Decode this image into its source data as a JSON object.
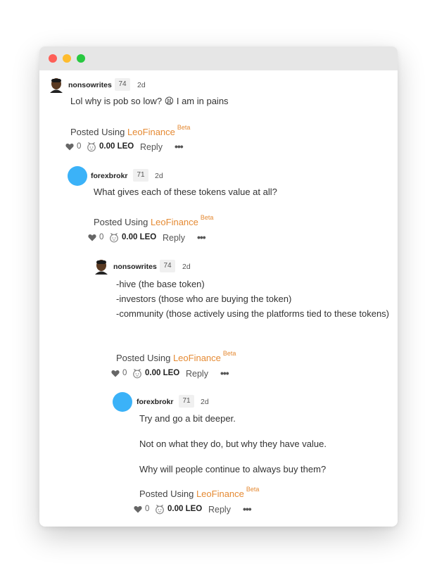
{
  "comments": [
    {
      "username": "nonsowrites",
      "reputation": "74",
      "time": "2d",
      "avatar": "avatar-person-icon",
      "body": [
        "Lol why is pob so low? 😫 I am in pains"
      ],
      "posted_prefix": "Posted Using",
      "posted_link": "LeoFinance",
      "posted_badge": "Beta",
      "votes": "0",
      "payout": "0.00 LEO",
      "reply_label": "Reply",
      "more_label": "•••"
    },
    {
      "username": "forexbrokr",
      "reputation": "71",
      "time": "2d",
      "avatar": "avatar-circle-blue",
      "body": [
        "What gives each of these tokens value at all?"
      ],
      "posted_prefix": "Posted Using",
      "posted_link": "LeoFinance",
      "posted_badge": "Beta",
      "votes": "0",
      "payout": "0.00 LEO",
      "reply_label": "Reply",
      "more_label": "•••"
    },
    {
      "username": "nonsowrites",
      "reputation": "74",
      "time": "2d",
      "avatar": "avatar-person-icon",
      "body": [
        "-hive (the base token)",
        "-investors (those who are buying the token)",
        "-community (those actively using the platforms tied to these tokens)"
      ],
      "posted_prefix": "Posted Using",
      "posted_link": "LeoFinance",
      "posted_badge": "Beta",
      "votes": "0",
      "payout": "0.00 LEO",
      "reply_label": "Reply",
      "more_label": "•••"
    },
    {
      "username": "forexbrokr",
      "reputation": "71",
      "time": "2d",
      "avatar": "avatar-circle-blue",
      "body": [
        "Try and go a bit deeper.",
        "Not on what they do, but why they have value.",
        "Why will people continue to always buy them?"
      ],
      "posted_prefix": "Posted Using",
      "posted_link": "LeoFinance",
      "posted_badge": "Beta",
      "votes": "0",
      "payout": "0.00 LEO",
      "reply_label": "Reply",
      "more_label": "•••"
    }
  ],
  "colors": {
    "accent_link": "#e58a33",
    "avatar_blue": "#3bb2f8",
    "titlebar": "#e6e6e6"
  }
}
